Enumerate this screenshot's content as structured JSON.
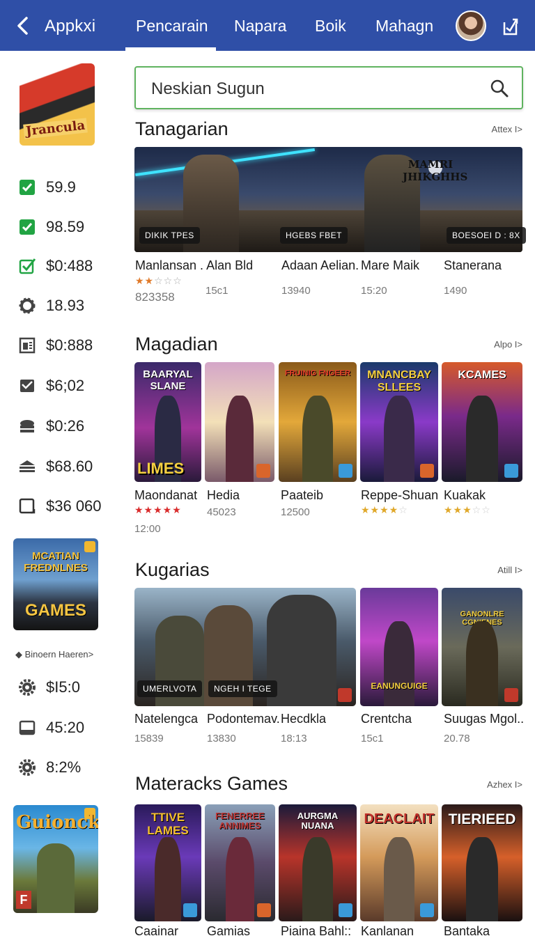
{
  "header": {
    "app_title": "Appkxi",
    "tabs": [
      {
        "label": "Pencarain",
        "active": true
      },
      {
        "label": "Napara"
      },
      {
        "label": "Boik"
      },
      {
        "label": "Mahagn"
      }
    ]
  },
  "sidebar": {
    "logo_text": "Jrancula",
    "stats_top": [
      {
        "icon": "check-icon",
        "value": "59.9"
      },
      {
        "icon": "check-icon",
        "value": "98.59"
      },
      {
        "icon": "check-outline-icon",
        "value": "$0:488"
      },
      {
        "icon": "gear-icon",
        "value": "18.93"
      },
      {
        "icon": "document-icon",
        "value": "$0:888"
      },
      {
        "icon": "mail-icon",
        "value": "$6;02"
      },
      {
        "icon": "stack-icon",
        "value": "$0:26"
      },
      {
        "icon": "layers-icon",
        "value": "$68.60"
      },
      {
        "icon": "square-icon",
        "value": "$36 060"
      }
    ],
    "card1": {
      "title": "MCATIAN FREDNLNES",
      "bottom": "GAMES"
    },
    "note": "◆ Binoern Haeren>",
    "stats_bottom": [
      {
        "icon": "gear-icon",
        "value": "$I5:0"
      },
      {
        "icon": "monitor-icon",
        "value": "45:20"
      },
      {
        "icon": "gear-icon",
        "value": "8:2%"
      }
    ],
    "card2": {
      "title": "Guionck",
      "badge": "F"
    }
  },
  "search": {
    "placeholder": "Neskian Sugun"
  },
  "sections": [
    {
      "title": "Tanagarian",
      "link": "Attex I>",
      "banner_logo": "MAMRI JHIKGHHS",
      "tags": [
        "DIKIK TPES",
        "HGEBS FBET",
        "BOESOEI D : 8X"
      ],
      "items": [
        {
          "name": "Manlansan . Alan Bld",
          "meta": "823358",
          "rating": 2
        },
        {
          "name": "",
          "meta": "15c1"
        },
        {
          "name": "Adaan Aelian.",
          "meta": "13940"
        },
        {
          "name": "Mare Maik",
          "meta": "15:20"
        },
        {
          "name": "Stanerana",
          "meta": "1490"
        }
      ]
    },
    {
      "title": "Magadian",
      "link": "Alpo I>",
      "cards": [
        {
          "title": "BAARYAL SLANE",
          "bottom": "LIMES",
          "name": "Maondanat",
          "rating": 5,
          "meta": "12:00"
        },
        {
          "title": "",
          "bottom": "",
          "name": "Hedia",
          "meta": "45023"
        },
        {
          "title": "FRUINIG FNGEER",
          "bottom": "",
          "name": "Paateib",
          "meta": "12500"
        },
        {
          "title": "MNANCBAY SLLEES",
          "bottom": "",
          "name": "Reppe-Shuan",
          "rating": 4
        },
        {
          "title": "KCAMES",
          "bottom": "",
          "name": "Kuakak",
          "rating": 3
        }
      ]
    },
    {
      "title": "Kugarias",
      "link": "Atill I>",
      "tags": [
        "UMERLVOTA",
        "NGEH I TEGE"
      ],
      "cards": [
        {
          "name": "Natelengca",
          "meta": "15839"
        },
        {
          "name": "Podontemav.",
          "meta": "13830"
        },
        {
          "name": "Hecdkla",
          "meta": "18:13"
        },
        {
          "title": "EANUNGUIGE",
          "name": "Crentcha",
          "meta": "15c1"
        },
        {
          "title": "GANONLRE CGNIENES",
          "name": "Suugas Mgol..",
          "meta": "20.78"
        }
      ]
    },
    {
      "title": "Materacks Games",
      "link": "Azhex I>",
      "cards": [
        {
          "title": "TTIVE LAMES",
          "name": "Caainar"
        },
        {
          "title": "FENERREE ANNIMES",
          "name": "Gamias"
        },
        {
          "title": "AURGMA NUANA",
          "name": "Piaina Bahl::"
        },
        {
          "title": "DEACLAIT",
          "name": "Kanlanan"
        },
        {
          "title": "TIERIEED",
          "name": "Bantaka"
        }
      ]
    }
  ],
  "colors": {
    "header": "#2f4fa7",
    "search_border": "#5fb35f",
    "star_red": "#d92b2b",
    "star_gold": "#e0a82a"
  }
}
